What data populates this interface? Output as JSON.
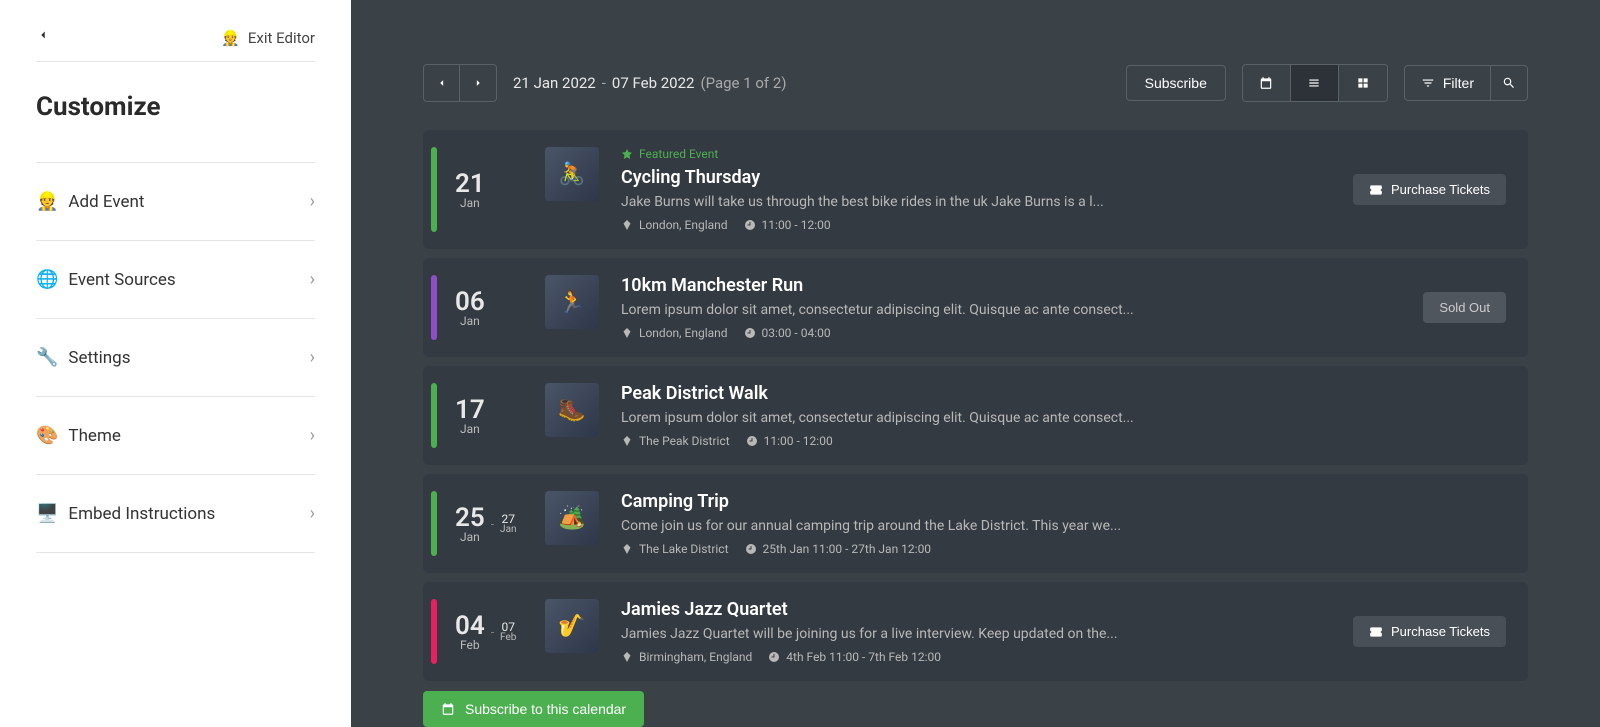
{
  "sidebar": {
    "exit_label": "Exit Editor",
    "exit_emoji": "👷",
    "title": "Customize",
    "items": [
      {
        "emoji": "👷",
        "label": "Add Event"
      },
      {
        "emoji": "🌐",
        "label": "Event Sources"
      },
      {
        "emoji": "🔧",
        "label": "Settings"
      },
      {
        "emoji": "🎨",
        "label": "Theme"
      },
      {
        "emoji": "🖥️",
        "label": "Embed Instructions"
      }
    ]
  },
  "toolbar": {
    "date_from": "21 Jan 2022",
    "date_to": "07 Feb 2022",
    "page_info": "(Page 1 of 2)",
    "subscribe_label": "Subscribe",
    "filter_label": "Filter"
  },
  "events": [
    {
      "color": "bar-green",
      "day": "21",
      "month": "Jan",
      "featured": true,
      "featured_label": "Featured Event",
      "title": "Cycling Thursday",
      "desc": "Jake Burns will take us through the best bike rides in the uk Jake Burns is a l...",
      "location": "London, England",
      "time": "11:00 - 12:00",
      "action": {
        "type": "purchase",
        "label": "Purchase Tickets"
      }
    },
    {
      "color": "bar-purple",
      "day": "06",
      "month": "Jan",
      "title": "10km Manchester Run",
      "desc": "Lorem ipsum dolor sit amet, consectetur adipiscing elit. Quisque ac ante consect...",
      "location": "London, England",
      "time": "03:00 - 04:00",
      "action": {
        "type": "soldout",
        "label": "Sold Out"
      }
    },
    {
      "color": "bar-green",
      "day": "17",
      "month": "Jan",
      "title": "Peak District Walk",
      "desc": "Lorem ipsum dolor sit amet, consectetur adipiscing elit. Quisque ac ante consect...",
      "location": "The Peak District",
      "time": "11:00 - 12:00",
      "action": null
    },
    {
      "color": "bar-green",
      "day": "25",
      "month": "Jan",
      "end_day": "27",
      "end_month": "Jan",
      "title": "Camping Trip",
      "desc": "Come join us for our annual camping trip around the Lake District. This year we...",
      "location": "The Lake District",
      "time": "25th Jan 11:00 - 27th Jan 12:00",
      "action": null
    },
    {
      "color": "bar-pink",
      "day": "04",
      "month": "Feb",
      "end_day": "07",
      "end_month": "Feb",
      "title": "Jamies Jazz Quartet",
      "desc": "Jamies Jazz Quartet will be joining us for a live interview. Keep updated on the...",
      "location": "Birmingham, England",
      "time": "4th Feb 11:00 - 7th Feb 12:00",
      "action": {
        "type": "purchase",
        "label": "Purchase Tickets"
      }
    }
  ],
  "bottom": {
    "subscribe_calendar_label": "Subscribe to this calendar"
  }
}
